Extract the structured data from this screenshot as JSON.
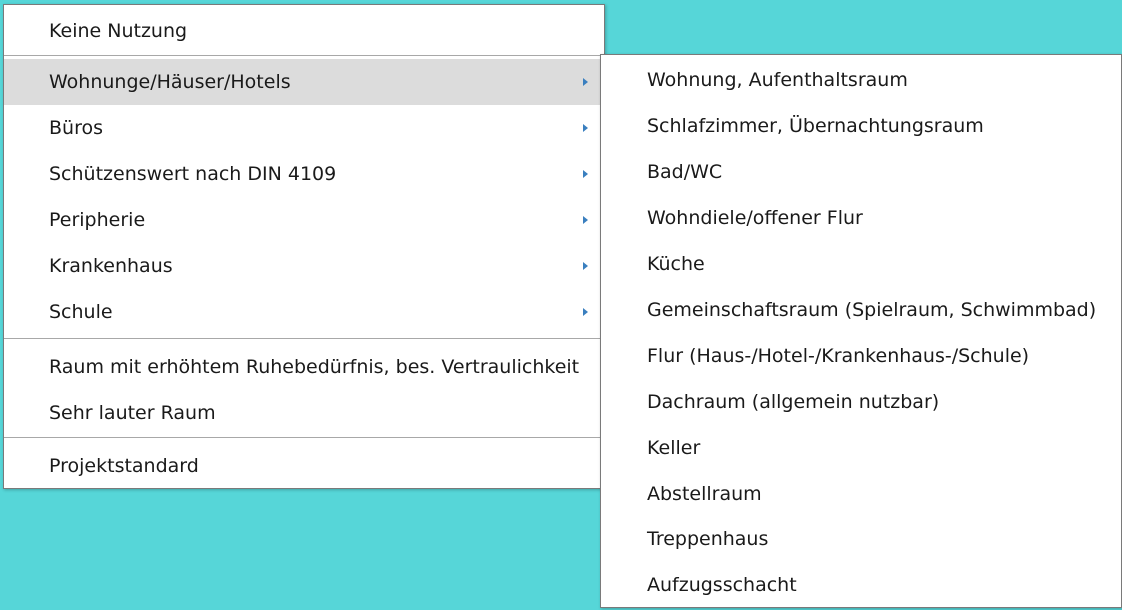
{
  "colors": {
    "background": "#56d6d8",
    "menu_bg": "#ffffff",
    "highlight": "#dcdcdc",
    "arrow": "#3a7fbf"
  },
  "main_menu": {
    "items": [
      {
        "label": "Keine Nutzung"
      },
      {
        "label": "Wohnunge/Häuser/Hotels"
      },
      {
        "label": "Büros"
      },
      {
        "label": "Schützenswert nach DIN 4109"
      },
      {
        "label": "Peripherie"
      },
      {
        "label": "Krankenhaus"
      },
      {
        "label": "Schule"
      },
      {
        "label": "Raum mit erhöhtem Ruhebedürfnis, bes. Vertraulichkeit"
      },
      {
        "label": "Sehr lauter Raum"
      },
      {
        "label": "Projektstandard"
      }
    ]
  },
  "submenu": {
    "items": [
      {
        "label": "Wohnung, Aufenthaltsraum"
      },
      {
        "label": "Schlafzimmer, Übernachtungsraum"
      },
      {
        "label": "Bad/WC"
      },
      {
        "label": "Wohndiele/offener Flur"
      },
      {
        "label": "Küche"
      },
      {
        "label": "Gemeinschaftsraum (Spielraum, Schwimmbad)"
      },
      {
        "label": "Flur (Haus-/Hotel-/Krankenhaus-/Schule)"
      },
      {
        "label": "Dachraum (allgemein nutzbar)"
      },
      {
        "label": "Keller"
      },
      {
        "label": "Abstellraum"
      },
      {
        "label": "Treppenhaus"
      },
      {
        "label": "Aufzugsschacht"
      }
    ]
  }
}
